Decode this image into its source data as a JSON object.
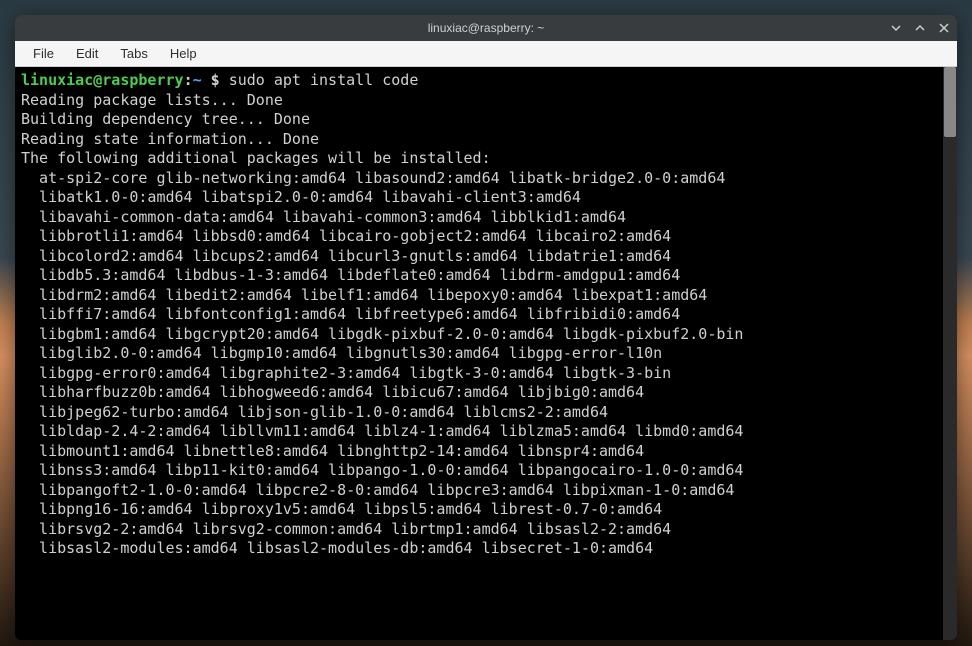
{
  "window": {
    "title": "linuxiac@raspberry: ~"
  },
  "menu": {
    "items": [
      "File",
      "Edit",
      "Tabs",
      "Help"
    ]
  },
  "prompt": {
    "user": "linuxiac",
    "at": "@",
    "host": "raspberry",
    "colon": ":",
    "path": "~",
    "symbol": " $ ",
    "command": "sudo apt install code"
  },
  "output": {
    "lines": [
      "Reading package lists... Done",
      "Building dependency tree... Done",
      "Reading state information... Done",
      "The following additional packages will be installed:"
    ],
    "packages": [
      "  at-spi2-core glib-networking:amd64 libasound2:amd64 libatk-bridge2.0-0:amd64",
      "  libatk1.0-0:amd64 libatspi2.0-0:amd64 libavahi-client3:amd64",
      "  libavahi-common-data:amd64 libavahi-common3:amd64 libblkid1:amd64",
      "  libbrotli1:amd64 libbsd0:amd64 libcairo-gobject2:amd64 libcairo2:amd64",
      "  libcolord2:amd64 libcups2:amd64 libcurl3-gnutls:amd64 libdatrie1:amd64",
      "  libdb5.3:amd64 libdbus-1-3:amd64 libdeflate0:amd64 libdrm-amdgpu1:amd64",
      "  libdrm2:amd64 libedit2:amd64 libelf1:amd64 libepoxy0:amd64 libexpat1:amd64",
      "  libffi7:amd64 libfontconfig1:amd64 libfreetype6:amd64 libfribidi0:amd64",
      "  libgbm1:amd64 libgcrypt20:amd64 libgdk-pixbuf-2.0-0:amd64 libgdk-pixbuf2.0-bin",
      "  libglib2.0-0:amd64 libgmp10:amd64 libgnutls30:amd64 libgpg-error-l10n",
      "  libgpg-error0:amd64 libgraphite2-3:amd64 libgtk-3-0:amd64 libgtk-3-bin",
      "  libharfbuzz0b:amd64 libhogweed6:amd64 libicu67:amd64 libjbig0:amd64",
      "  libjpeg62-turbo:amd64 libjson-glib-1.0-0:amd64 liblcms2-2:amd64",
      "  libldap-2.4-2:amd64 libllvm11:amd64 liblz4-1:amd64 liblzma5:amd64 libmd0:amd64",
      "  libmount1:amd64 libnettle8:amd64 libnghttp2-14:amd64 libnspr4:amd64",
      "  libnss3:amd64 libp11-kit0:amd64 libpango-1.0-0:amd64 libpangocairo-1.0-0:amd64",
      "  libpangoft2-1.0-0:amd64 libpcre2-8-0:amd64 libpcre3:amd64 libpixman-1-0:amd64",
      "  libpng16-16:amd64 libproxy1v5:amd64 libpsl5:amd64 librest-0.7-0:amd64",
      "  librsvg2-2:amd64 librsvg2-common:amd64 librtmp1:amd64 libsasl2-2:amd64",
      "  libsasl2-modules:amd64 libsasl2-modules-db:amd64 libsecret-1-0:amd64"
    ]
  }
}
